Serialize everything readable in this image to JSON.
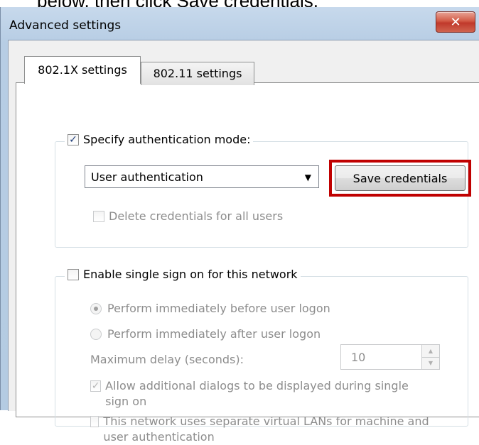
{
  "caption": "below, then click Save credentials.",
  "window": {
    "title": "Advanced settings",
    "close_glyph": "✕"
  },
  "tabs": [
    {
      "label": "802.1X settings",
      "active": true
    },
    {
      "label": "802.11 settings",
      "active": false
    }
  ],
  "auth_group": {
    "checkbox_label": "Specify authentication mode:",
    "checked": true,
    "mode_select": {
      "value": "User authentication"
    },
    "save_button": "Save credentials",
    "delete_label": "Delete credentials for all users"
  },
  "sso_group": {
    "checkbox_label": "Enable single sign on for this network",
    "checked": false,
    "radio_before": "Perform immediately before user logon",
    "radio_after": "Perform immediately after user logon",
    "delay_label": "Maximum delay (seconds):",
    "delay_value": "10",
    "allow_dialogs_label": "Allow additional dialogs to be displayed during single sign on",
    "allow_dialogs_checked": true,
    "vlan_label": "This network uses separate virtual LANs for machine and user authentication",
    "vlan_checked": false
  },
  "colors": {
    "highlight": "#c00000",
    "close_button": "#c0392b"
  },
  "icons": {
    "close": "close-icon",
    "dropdown": "chevron-down-icon",
    "spin_up": "arrow-up-icon",
    "spin_down": "arrow-down-icon"
  }
}
